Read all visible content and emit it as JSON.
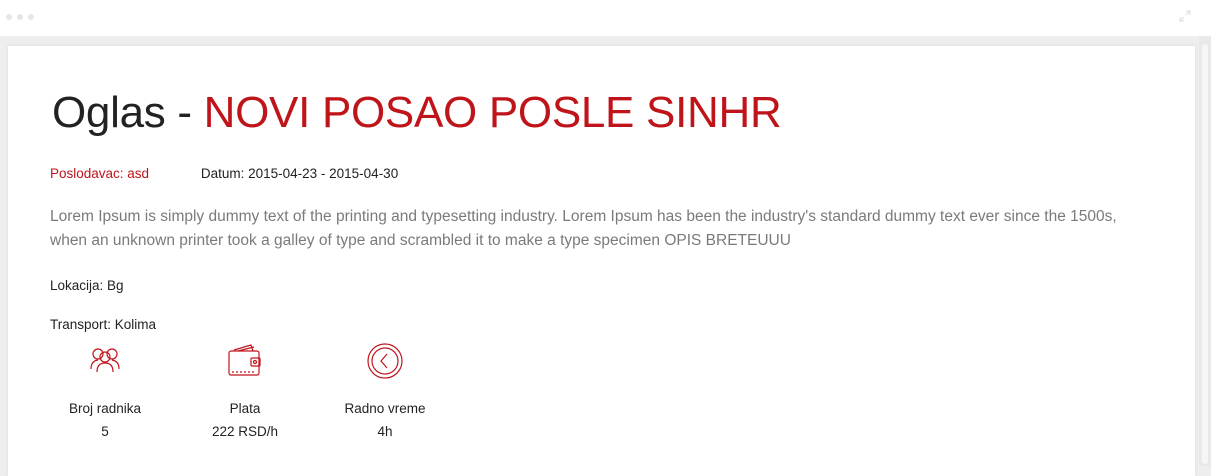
{
  "title": {
    "prefix": "Oglas - ",
    "name": "NOVI POSAO POSLE SINHR"
  },
  "meta": {
    "employer": "Poslodavac: asd",
    "date": "Datum: 2015-04-23 - 2015-04-30"
  },
  "description": "Lorem Ipsum is simply dummy text of the printing and typesetting industry. Lorem Ipsum has been the industry's standard dummy text ever since the 1500s, when an unknown printer took a galley of type and scrambled it to make a type specimen OPIS BRETEUUU",
  "location": "Lokacija: Bg",
  "transport": "Transport: Kolima",
  "stats": [
    {
      "icon": "people-icon",
      "label": "Broj radnika",
      "value": "5"
    },
    {
      "icon": "wallet-icon",
      "label": "Plata",
      "value": "222 RSD/h"
    },
    {
      "icon": "clock-icon",
      "label": "Radno vreme",
      "value": "4h"
    }
  ],
  "colors": {
    "accent": "#c0141b",
    "text": "#222222",
    "muted": "#7a7a7a"
  }
}
